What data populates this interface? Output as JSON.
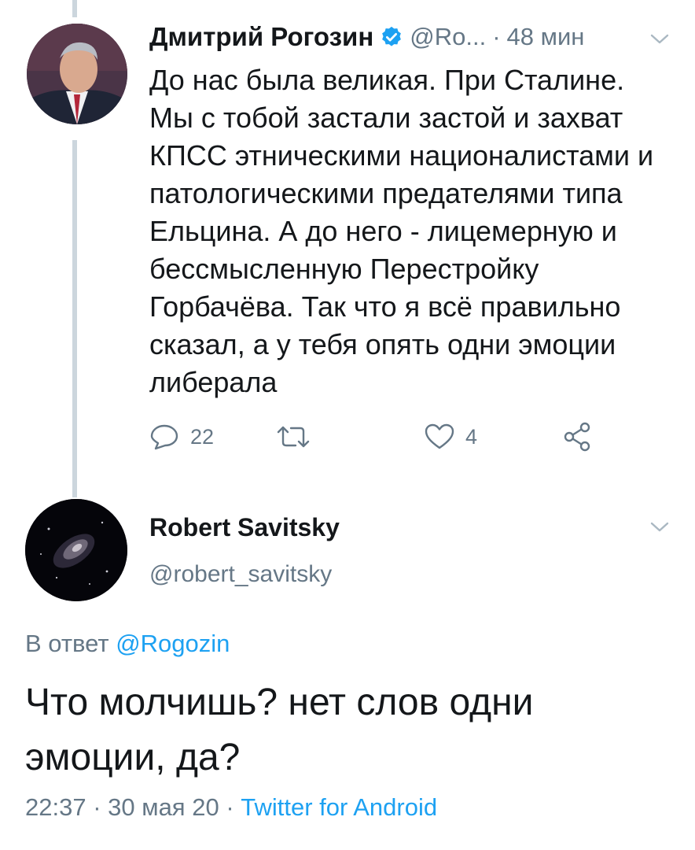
{
  "colors": {
    "text_primary": "#14171a",
    "text_secondary": "#657786",
    "link": "#1da1f2",
    "thread_line": "#ccd6dd"
  },
  "tweet_parent": {
    "author_name": "Дмитрий Рогозин",
    "verified_icon": "verified-badge-icon",
    "handle": "@Ro...",
    "separator": "·",
    "time_ago": "48 мин",
    "menu_icon": "chevron-down-icon",
    "text_lines": [
      "До нас была великая. При Сталине.",
      "Мы с тобой застали застой и захват",
      "КПСС этническими националистами и",
      "патологическими предателями типа",
      "Ельцина. А до него - лицемерную и",
      "бессмысленную Перестройку",
      "Горбачёва. Так что я всё правильно",
      "сказал, а у тебя опять одни эмоции",
      "либерала"
    ],
    "actions": {
      "reply_count": "22",
      "retweet_count": "",
      "like_count": "4"
    }
  },
  "tweet_reply": {
    "author_name": "Robert Savitsky",
    "handle": "@robert_savitsky",
    "menu_icon": "chevron-down-icon",
    "reply_to_label": "В ответ",
    "reply_to_mention": "@Rogozin",
    "text_lines": [
      "Что молчишь? нет слов одни",
      "эмоции, да?"
    ],
    "time": "22:37",
    "separator1": "·",
    "date": "30 мая 20",
    "separator2": "·",
    "source": "Twitter for Android"
  }
}
